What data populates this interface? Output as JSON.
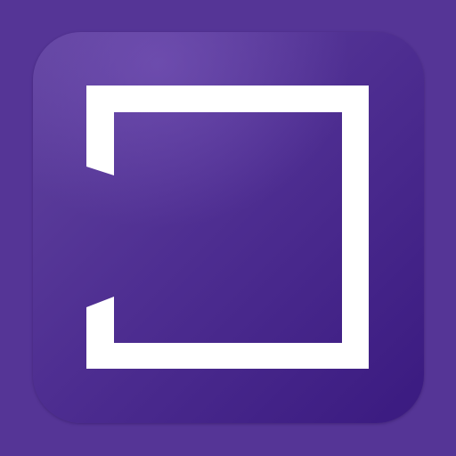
{
  "app_icon": {
    "icon_name": "bracket-square-logo-icon",
    "colors": {
      "background": "#553596",
      "tile_light": "#61449f",
      "tile_dark": "#3a1a80",
      "mark": "#ffffff"
    }
  }
}
